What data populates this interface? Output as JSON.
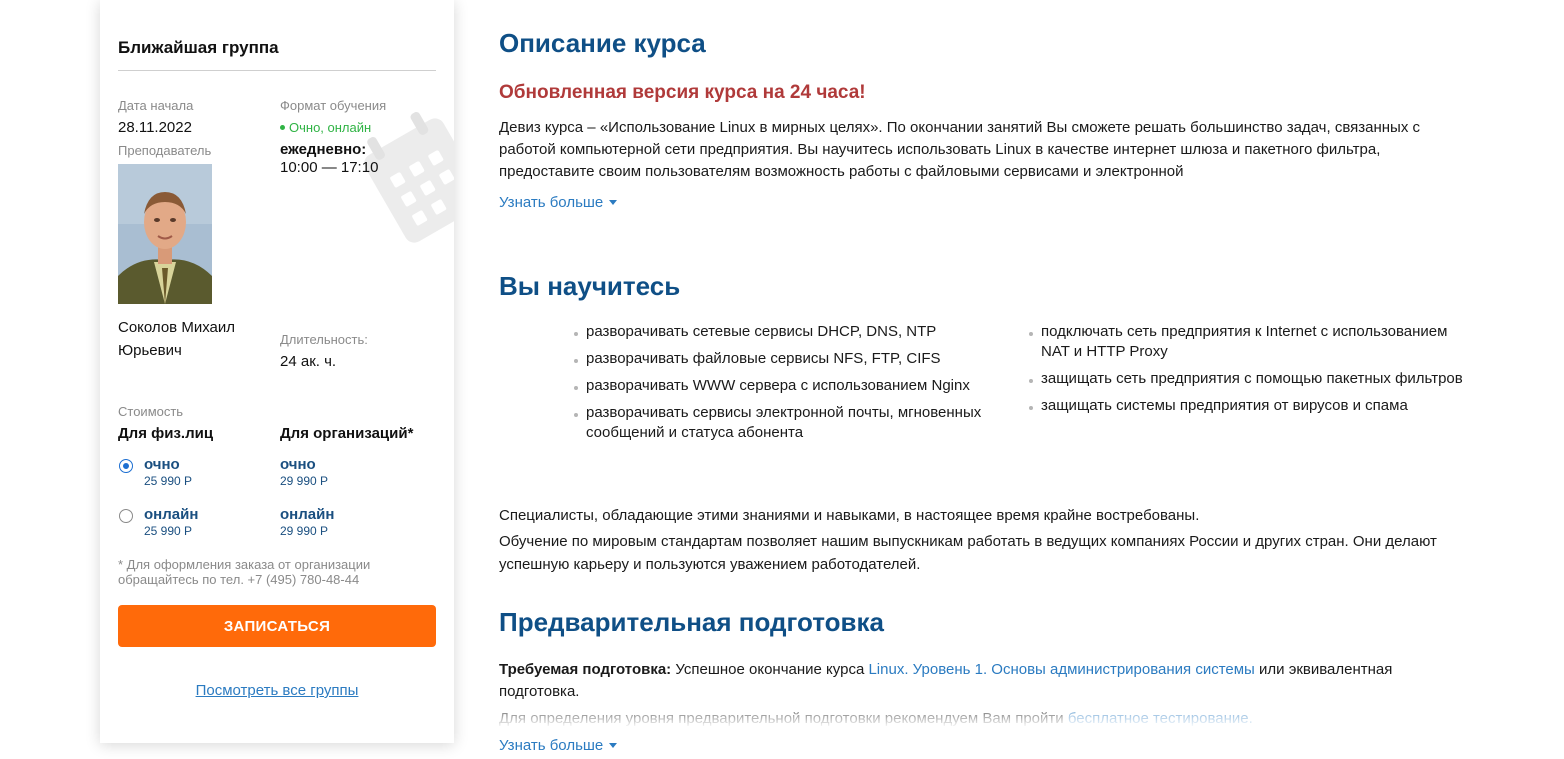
{
  "sidebar": {
    "title": "Ближайшая группа",
    "start_date_label": "Дата начала",
    "start_date": "28.11.2022",
    "format_label": "Формат обучения",
    "format_value": "Очно, онлайн",
    "schedule_days": "ежедневно:",
    "schedule_time": "10:00 — 17:10",
    "teacher_label": "Преподаватель",
    "teacher_name": "Соколов Михаил Юрьевич",
    "duration_label": "Длительность:",
    "duration_value": "24 ак. ч.",
    "cost_label": "Стоимость",
    "individuals_head": "Для физ.лиц",
    "org_head": "Для организаций*",
    "options": [
      {
        "name": "очно",
        "price": "25 990 Р",
        "org_name": "очно",
        "org_price": "29 990 Р",
        "selected": true
      },
      {
        "name": "онлайн",
        "price": "25 990 Р",
        "org_name": "онлайн",
        "org_price": "29 990 Р",
        "selected": false
      }
    ],
    "footnote": "* Для оформления заказа от организации обращайтесь по тел. +7 (495) 780-48-44",
    "enroll_button": "ЗАПИСАТЬСЯ",
    "all_groups_link": "Посмотреть все группы"
  },
  "main": {
    "description_title": "Описание курса",
    "updated_heading": "Обновленная версия курса на 24 часа!",
    "description_text": "Девиз курса – «Использование Linux в мирных целях». По окончании занятий Вы сможете решать большинство задач, связанных с работой компьютерной сети предприятия. Вы научитесь использовать Linux в качестве интернет шлюза и пакетного фильтра, предоставите своим пользователям возможность работы с файловыми сервисами и электронной",
    "more_link": "Узнать больше",
    "learn_title": "Вы научитесь",
    "skills_left": [
      "разворачивать сетевые сервисы DHCP, DNS, NTP",
      "разворачивать файловые сервисы NFS, FTP, CIFS",
      "разворачивать WWW сервера с использованием Nginx",
      "разворачивать сервисы электронной почты, мгновенных сообщений и статуса абонента"
    ],
    "skills_right": [
      "подключать сеть предприятия к Internet с использованием NAT и HTTP Proxy",
      "защищать сеть предприятия с помощью пакетных фильтров",
      "защищать системы предприятия от вирусов и спама"
    ],
    "specialists_text": "Специалисты, обладающие этими знаниями и навыками, в настоящее время крайне востребованы.",
    "standards_text": "Обучение по мировым стандартам позволяет нашим выпускникам работать в ведущих компаниях России и других стран. Они делают успешную карьеру и пользуются уважением работодателей.",
    "prereq_title": "Предварительная подготовка",
    "prereq_label": "Требуемая подготовка:",
    "prereq_text_before": " Успешное окончание курса ",
    "prereq_course_link": "Linux. Уровень 1. Основы администрирования системы",
    "prereq_text_after": " или эквивалентная подготовка.",
    "test_text": "Для определения уровня предварительной подготовки рекомендуем Вам пройти ",
    "test_link": "бесплатное тестирование.",
    "more_link_2": "Узнать больше"
  },
  "colors": {
    "heading_blue": "#0f4f86",
    "accent_red": "#b03a3a",
    "link_blue": "#2b7bc1",
    "button_orange": "#ff6a0a",
    "status_green": "#2fb344"
  },
  "icons": [
    "calendar-watermark-icon",
    "status-dot-icon",
    "caret-down-icon"
  ]
}
